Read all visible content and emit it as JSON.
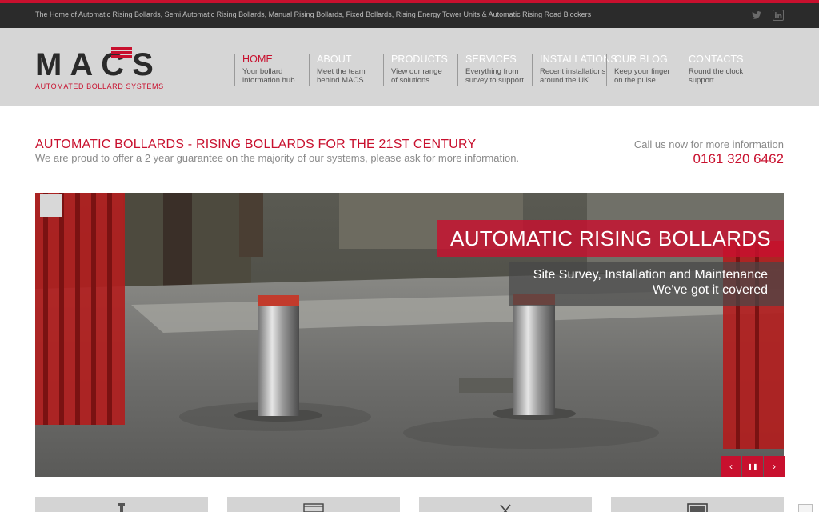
{
  "topbar": {
    "tagline": "The Home of Automatic Rising Bollards, Semi Automatic Rising Bollards, Manual Rising Bollards, Fixed Bollards, Rising Energy Tower Units & Automatic Rising Road Blockers",
    "social": [
      {
        "name": "twitter-icon"
      },
      {
        "name": "linkedin-icon"
      }
    ]
  },
  "logo": {
    "mark": "MACS",
    "subtitle": "AUTOMATED BOLLARD SYSTEMS"
  },
  "nav": [
    {
      "title": "HOME",
      "desc": [
        "Your bollard",
        "information hub"
      ],
      "active": true
    },
    {
      "title": "ABOUT",
      "desc": [
        "Meet the team",
        "behind MACS"
      ],
      "active": false
    },
    {
      "title": "PRODUCTS",
      "desc": [
        "View our range",
        "of solutions"
      ],
      "active": false
    },
    {
      "title": "SERVICES",
      "desc": [
        "Everything from",
        "survey to support"
      ],
      "active": false
    },
    {
      "title": "INSTALLATIONS",
      "desc": [
        "Recent installations",
        "around the UK."
      ],
      "active": false
    },
    {
      "title": "OUR BLOG",
      "desc": [
        "Keep your finger",
        "on the pulse"
      ],
      "active": false
    },
    {
      "title": "CONTACTS",
      "desc": [
        "Round the clock",
        "support"
      ],
      "active": false
    }
  ],
  "intro": {
    "headline": "AUTOMATIC BOLLARDS - RISING BOLLARDS FOR THE 21ST CENTURY",
    "subline": "We are proud to offer a 2 year guarantee on the majority of our systems, please ask for more information.",
    "call_label": "Call us now for more information",
    "phone": "0161 320 6462"
  },
  "slider": {
    "title": "AUTOMATIC RISING BOLLARDS",
    "sub_line1": "Site Survey, Installation and Maintenance",
    "sub_line2": "We've got it covered",
    "controls": {
      "prev": "‹",
      "pause": "❚❚",
      "next": "›"
    }
  },
  "tiles": [
    {
      "icon": "bollard-icon"
    },
    {
      "icon": "box-icon"
    },
    {
      "icon": "tools-icon"
    },
    {
      "icon": "monitor-icon"
    }
  ],
  "colors": {
    "accent": "#c8102e",
    "topbar": "#2b2b2b",
    "header": "#d6d6d6"
  }
}
